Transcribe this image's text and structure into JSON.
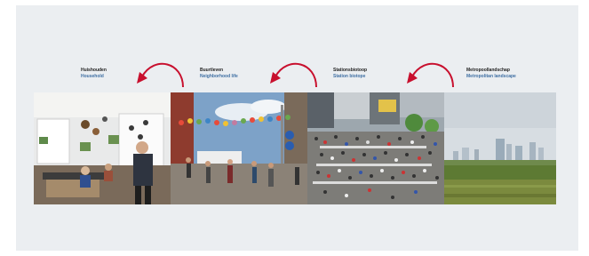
{
  "scales": [
    {
      "nl": "Huishouden",
      "en": "Household"
    },
    {
      "nl": "Buurtleven",
      "en": "Neighborhood life"
    },
    {
      "nl": "Stationsbiotoop",
      "en": "Station biotope"
    },
    {
      "nl": "Metropoollandschap",
      "en": "Metropolitan landscape"
    }
  ],
  "colors": {
    "arrow": "#c8102e",
    "label_en": "#3f6fa3",
    "background": "#ebeef1"
  },
  "images": [
    "household-interior-photo",
    "street-festival-photo",
    "station-crowd-photo",
    "skyline-landscape-photo"
  ]
}
